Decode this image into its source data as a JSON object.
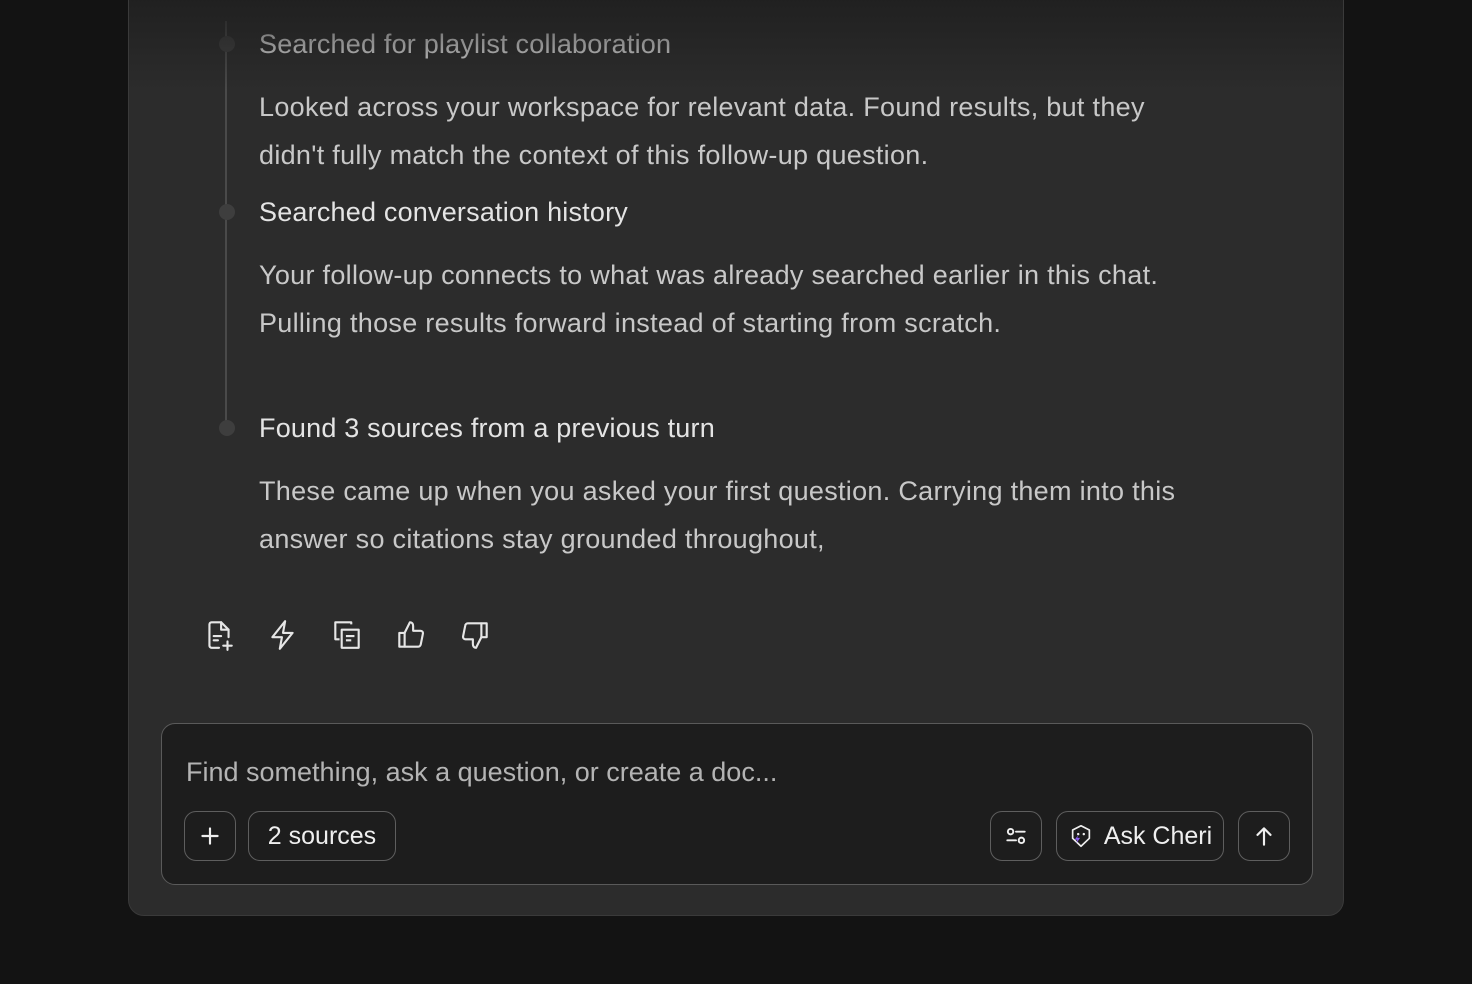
{
  "steps": [
    {
      "title": "Searched for playlist collaboration",
      "description": "Looked across your workspace for relevant data. Found results, but they didn't fully match the context of this follow-up question."
    },
    {
      "title": "Searched conversation history",
      "description": "Your follow-up connects to what was already searched earlier in this chat. Pulling those results forward instead of starting from scratch."
    },
    {
      "title": "Found 3 sources from a previous turn",
      "description": "These came up when you asked your first question. Carrying them into this answer so citations stay grounded throughout,"
    }
  ],
  "actions": [
    {
      "icon": "file-add-icon"
    },
    {
      "icon": "lightning-icon"
    },
    {
      "icon": "copy-icon"
    },
    {
      "icon": "thumbs-up-icon"
    },
    {
      "icon": "thumbs-down-icon"
    }
  ],
  "composer": {
    "placeholder": "Find something, ask a question, or create a doc...",
    "value": "",
    "sources_label": "2 sources",
    "ask_label": "Ask Cheri"
  },
  "colors": {
    "background": "#131313",
    "panel": "#2c2c2c",
    "composer": "#1d1d1d",
    "accent": "#8b5cf6"
  }
}
